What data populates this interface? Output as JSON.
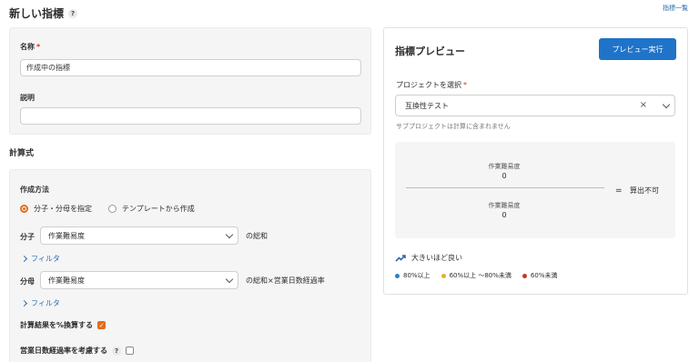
{
  "page": {
    "title": "新しい指標",
    "help_icon": "?",
    "top_link": "指標一覧"
  },
  "basic": {
    "name_label": "名称",
    "required_mark": "*",
    "name_value": "作成中の指標",
    "desc_label": "説明",
    "desc_value": ""
  },
  "formula_section": {
    "title": "計算式",
    "method_label": "作成方法",
    "method_options": [
      "分子・分母を指定",
      "テンプレートから作成"
    ],
    "method_selected": 0,
    "numerator_label": "分子",
    "numerator_value": "作業難易度",
    "numerator_suffix": "の総和",
    "denominator_label": "分母",
    "denominator_value": "作業難易度",
    "denominator_suffix": "の総和×営業日数経過率",
    "filter_label": "フィルタ",
    "percent_label": "計算結果を%換算する",
    "percent_checked": true,
    "business_days_label": "営業日数経過率を考慮する",
    "business_days_checked": false
  },
  "preview": {
    "title": "指標プレビュー",
    "run_button": "プレビュー実行",
    "project_label": "プロジェクトを選択",
    "project_value": "互換性テスト",
    "clear_icon": "×",
    "note": "サブプロジェクトは計算に含まれません",
    "numerator_name": "作業難易度",
    "numerator_value": "0",
    "denominator_name": "作業難易度",
    "denominator_value": "0",
    "equals": "=",
    "result": "算出不可",
    "trend_label": "大きいほど良い",
    "legend": [
      {
        "label": "80%以上",
        "color": "#2f7fc1"
      },
      {
        "label": "60%以上 〜80%未満",
        "color": "#e0b52b"
      },
      {
        "label": "60%未満",
        "color": "#c0392b"
      }
    ]
  }
}
